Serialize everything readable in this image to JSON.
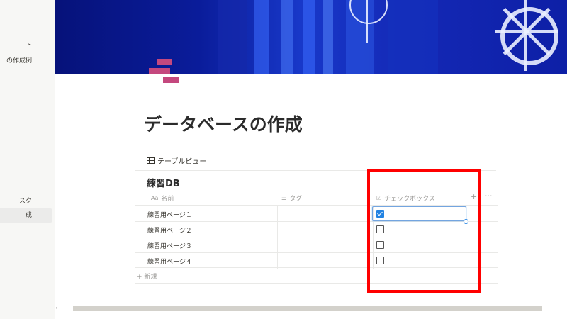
{
  "sidebar": {
    "items": [
      {
        "label": "ト",
        "top": 0
      },
      {
        "label": "の作成例"
      },
      {
        "label": "スク"
      },
      {
        "label": "成"
      }
    ],
    "collapse_glyph": "‹"
  },
  "page": {
    "icon": "stacked-bars-icon",
    "title": "データベースの作成"
  },
  "database": {
    "view_tab": "テーブルビュー",
    "title": "練習DB",
    "columns": [
      {
        "icon": "Aa",
        "label": "名前"
      },
      {
        "icon": "☰",
        "label": "タグ"
      },
      {
        "icon": "☑",
        "label": "チェックボックス"
      }
    ],
    "add_column": "+",
    "more": "···",
    "rows": [
      {
        "name": "練習用ページ１",
        "checked": true
      },
      {
        "name": "練習用ページ２",
        "checked": false
      },
      {
        "name": "練習用ページ３",
        "checked": false
      },
      {
        "name": "練習用ページ４",
        "checked": false
      }
    ],
    "new_row": "+ 新規"
  },
  "colors": {
    "highlight": "#ff0000",
    "checkbox_checked": "#2383e2",
    "page_icon": "#c4487e",
    "cover": "#1428b5"
  }
}
